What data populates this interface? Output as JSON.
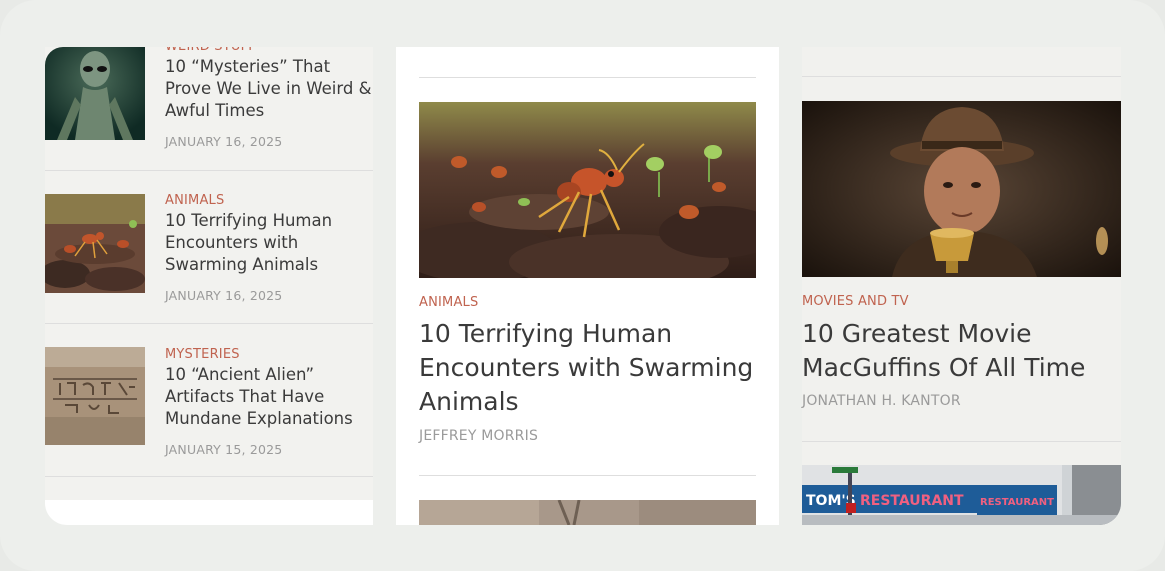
{
  "sidebar": {
    "items": [
      {
        "category": "WEIRD STUFF",
        "title": "10 “Mysteries” That Prove We Live in Weird & Awful Times",
        "date": "JANUARY 16, 2025",
        "thumb": "alien-figure"
      },
      {
        "category": "ANIMALS",
        "title": "10 Terrifying Human Encounters with Swarming Animals",
        "date": "JANUARY 16, 2025",
        "thumb": "ants"
      },
      {
        "category": "MYSTERIES",
        "title": "10 “Ancient Alien” Artifacts That Have Mundane Explanations",
        "date": "JANUARY 15, 2025",
        "thumb": "hieroglyphs"
      }
    ]
  },
  "center": {
    "category": "ANIMALS",
    "title": "10 Terrifying Human Encounters with Swarming Animals",
    "author": "JEFFREY MORRIS",
    "image": "ants-swarm"
  },
  "right": {
    "category": "MOVIES AND TV",
    "title": "10 Greatest Movie MacGuffins Of All Time",
    "author": "JONATHAN H. KANTOR",
    "image": "adventurer-with-chalice",
    "next_sign_left": "TOM'S",
    "next_sign_main": "RESTAURANT",
    "next_sign_side": "RESTAURANT"
  },
  "colors": {
    "category": "#c0634f",
    "title": "#3a3a3a",
    "meta": "#9a9a9a"
  }
}
